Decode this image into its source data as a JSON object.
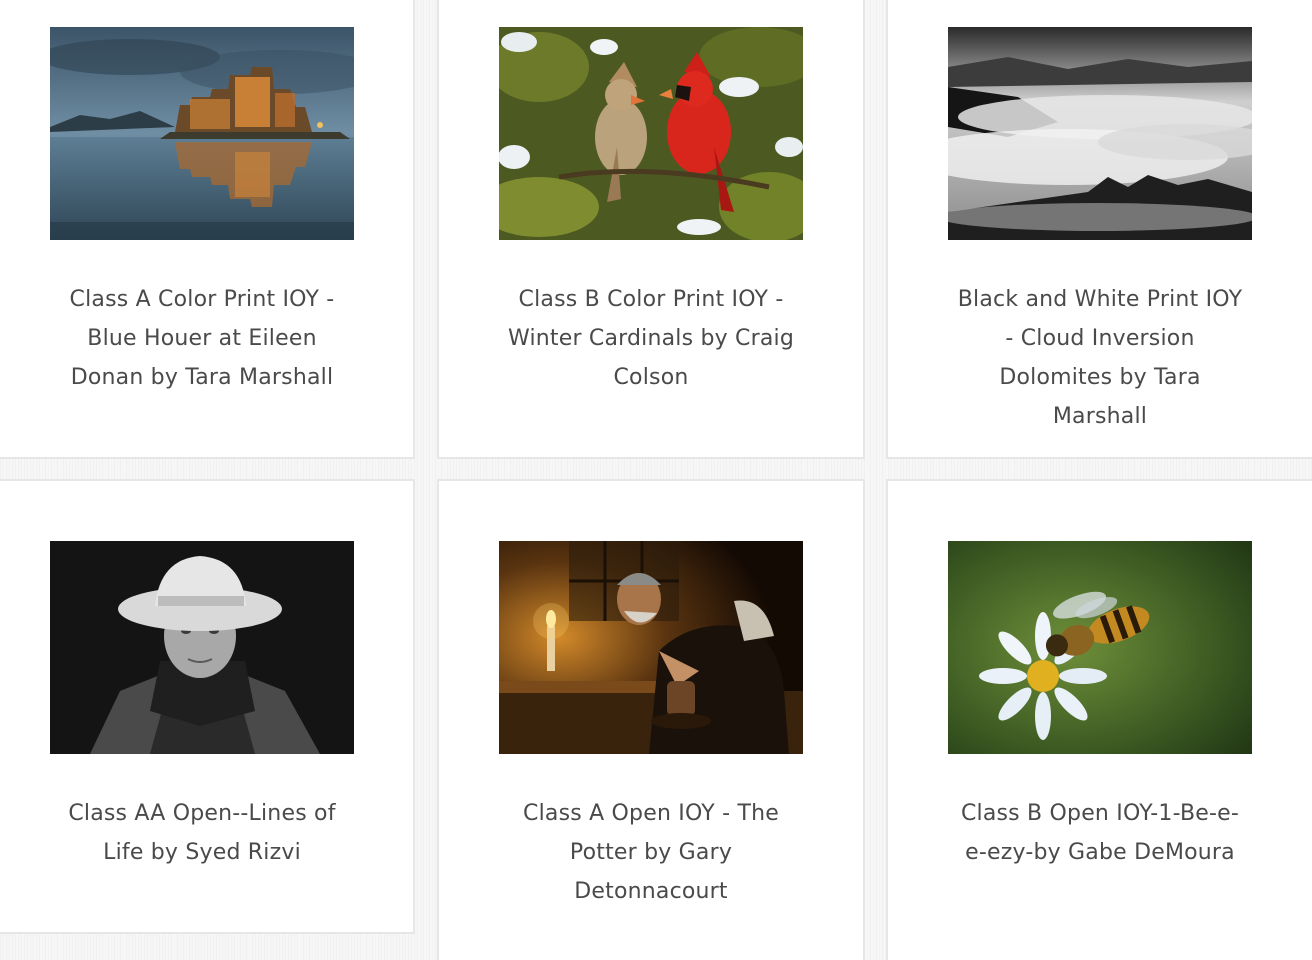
{
  "gallery": {
    "items": [
      {
        "caption": "Class A Color Print IOY - Blue Houer at Eileen Donan by Tara Marshall"
      },
      {
        "caption": "Class B Color Print IOY - Winter Cardinals by Craig Colson"
      },
      {
        "caption": "Black and White Print IOY - Cloud Inversion Dolomites by Tara Marshall"
      },
      {
        "caption": "Class AA Open--Lines of Life by Syed Rizvi"
      },
      {
        "caption": "Class A Open IOY - The Potter by Gary Detonnacourt"
      },
      {
        "caption": "Class B Open IOY-1-Be-e-e-ezy-by Gabe DeMoura"
      }
    ]
  },
  "colors": {
    "background": "#f7f7f7",
    "card": "#ffffff",
    "card_border": "#e6e6e6",
    "caption_text": "#4a4a4a"
  }
}
